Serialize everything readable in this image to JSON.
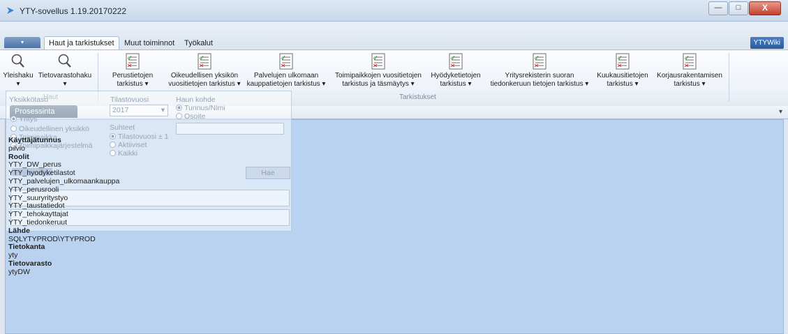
{
  "window": {
    "title": "YTY-sovellus 1.19.20170222",
    "minimize_label": "—",
    "maximize_label": "□",
    "close_label": "X"
  },
  "tabs": {
    "app_menu_label": "▾",
    "items": [
      {
        "label": "Haut ja tarkistukset"
      },
      {
        "label": "Muut toiminnot"
      },
      {
        "label": "Työkalut"
      }
    ],
    "wiki_label": "YTYWiki"
  },
  "ribbon": {
    "groups": {
      "haut": "Haut",
      "tarkistukset": "Tarkistukset"
    },
    "buttons": [
      {
        "line1": "Yleishaku",
        "line2": "▾"
      },
      {
        "line1": "Tietovarastohaku",
        "line2": "▾"
      },
      {
        "line1": "Perustietojen",
        "line2": "tarkistus ▾"
      },
      {
        "line1": "Oikeudellisen yksikön",
        "line2": "vuositietojen tarkistus ▾"
      },
      {
        "line1": "Palvelujen ulkomaan",
        "line2": "kauppatietojen tarkistus ▾"
      },
      {
        "line1": "Toimipaikkojen vuositietojen",
        "line2": "tarkistus ja täsmäytys ▾"
      },
      {
        "line1": "Hyödyketietojen",
        "line2": "tarkistus ▾"
      },
      {
        "line1": "Yritysrekisterin suoran",
        "line2": "tiedonkeruun tietojen tarkistus ▾"
      },
      {
        "line1": "Kuukausitietojen",
        "line2": "tarkistus ▾"
      },
      {
        "line1": "Korjausrakentamisen",
        "line2": "tarkistus ▾"
      }
    ]
  },
  "doc_tab": {
    "label": "Prosessinäkymä",
    "display": "Prosessinta"
  },
  "collapse_arrow": "▾",
  "search_panel": {
    "yksikkotaso_label": "Yksikkötaso",
    "tilastovuosi_label": "Tilastovuosi",
    "tilastovuosi_value": "2017",
    "haun_kohde_label": "Haun kohde",
    "kohde_tunnus": "Tunnus/Nimi",
    "kohde_osoite": "Osoite",
    "yksikko_yritys": "Yritys",
    "yksikko_oik": "Oikeudellinen yksikkö",
    "yksikko_toimipaikka": "Toimipaikka",
    "yksikko_tpjarj": "Toimipaikkajärjestelmä",
    "suhteet_label": "Suhteet",
    "suhde_1": "Tilastovuosi ± 1",
    "suhde_2": "Aktiiviset",
    "suhde_3": "Kaikki",
    "hae_label": "Hae"
  },
  "info": [
    {
      "kind": "k",
      "text": "Käyttäjätunnus"
    },
    {
      "kind": "v",
      "text": "pilvio"
    },
    {
      "kind": "k",
      "text": "Roolit"
    },
    {
      "kind": "v",
      "text": "YTY_DW_perus"
    },
    {
      "kind": "v",
      "text": "YTY_hyodyketilastot"
    },
    {
      "kind": "v",
      "text": "YTY_palvelujen_ulkomaankauppa"
    },
    {
      "kind": "v",
      "text": "YTY_perusrooli"
    },
    {
      "kind": "v",
      "text": "YTY_suuryritystyo"
    },
    {
      "kind": "v",
      "text": "YTY_taustatiedot"
    },
    {
      "kind": "v",
      "text": "YTY_tehokayttajat"
    },
    {
      "kind": "v",
      "text": "YTY_tiedonkeruut"
    },
    {
      "kind": "k",
      "text": "Lähde"
    },
    {
      "kind": "v",
      "text": "SQLYTYPROD\\YTYPROD"
    },
    {
      "kind": "k",
      "text": "Tietokanta"
    },
    {
      "kind": "v",
      "text": "yty"
    },
    {
      "kind": "k",
      "text": "Tietovarasto"
    },
    {
      "kind": "v",
      "text": "ytyDW"
    }
  ]
}
